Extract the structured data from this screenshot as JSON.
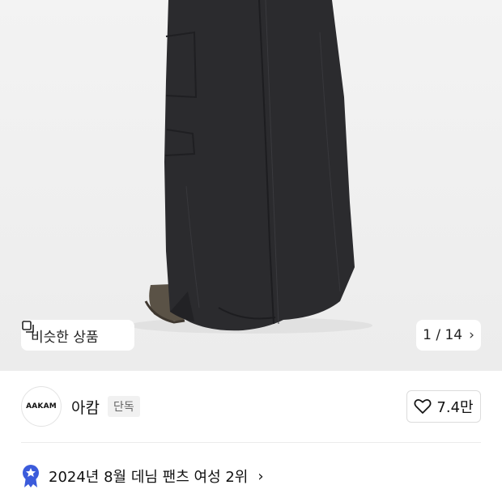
{
  "gallery": {
    "similar_label": "비슷한 상품",
    "current": "1",
    "separator": "/",
    "total": "14"
  },
  "brand": {
    "logo_text": "AAKAM",
    "name": "아캄",
    "badge": "단독"
  },
  "like": {
    "count": "7.4만"
  },
  "ranking": {
    "text": "2024년 8월 데님 팬츠 여성 2위"
  },
  "colors": {
    "ranking_badge": "#3b5bdb",
    "garment": "#2b2b2e"
  }
}
